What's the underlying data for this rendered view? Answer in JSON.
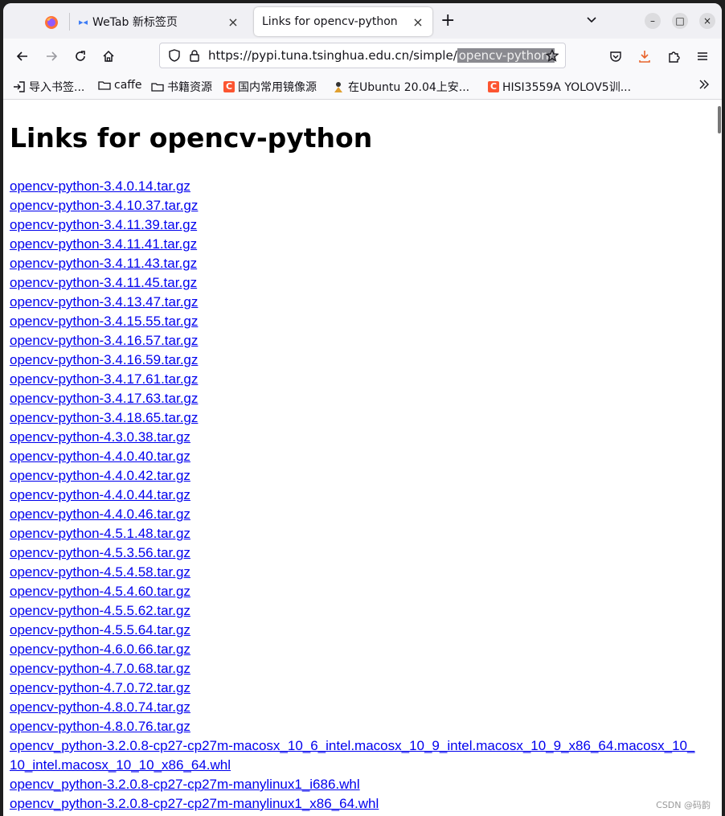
{
  "tabs": [
    {
      "title": "WeTab 新标签页",
      "close": "×"
    },
    {
      "title": "Links for opencv-python",
      "close": "×"
    }
  ],
  "window_controls": {
    "minimize": "–",
    "maximize": "□",
    "close": "×"
  },
  "url": {
    "base": "https://pypi.tuna.tsinghua.edu.cn/simple/",
    "selected": "opencv-python/"
  },
  "bookmarks": [
    {
      "label": "导入书签...",
      "icon": "import-icon"
    },
    {
      "label": "caffe",
      "icon": "folder-icon"
    },
    {
      "label": "书籍资源",
      "icon": "folder-icon"
    },
    {
      "label": "国内常用镜像源",
      "icon": "csdn-icon"
    },
    {
      "label": "在Ubuntu 20.04上安...",
      "icon": "ubuntu-icon"
    },
    {
      "label": "HISI3559A YOLOV5训...",
      "icon": "csdn-icon"
    }
  ],
  "page": {
    "title": "Links for opencv-python",
    "links": [
      "opencv-python-3.4.0.14.tar.gz",
      "opencv-python-3.4.10.37.tar.gz",
      "opencv-python-3.4.11.39.tar.gz",
      "opencv-python-3.4.11.41.tar.gz",
      "opencv-python-3.4.11.43.tar.gz",
      "opencv-python-3.4.11.45.tar.gz",
      "opencv-python-3.4.13.47.tar.gz",
      "opencv-python-3.4.15.55.tar.gz",
      "opencv-python-3.4.16.57.tar.gz",
      "opencv-python-3.4.16.59.tar.gz",
      "opencv-python-3.4.17.61.tar.gz",
      "opencv-python-3.4.17.63.tar.gz",
      "opencv-python-3.4.18.65.tar.gz",
      "opencv-python-4.3.0.38.tar.gz",
      "opencv-python-4.4.0.40.tar.gz",
      "opencv-python-4.4.0.42.tar.gz",
      "opencv-python-4.4.0.44.tar.gz",
      "opencv-python-4.4.0.46.tar.gz",
      "opencv-python-4.5.1.48.tar.gz",
      "opencv-python-4.5.3.56.tar.gz",
      "opencv-python-4.5.4.58.tar.gz",
      "opencv-python-4.5.4.60.tar.gz",
      "opencv-python-4.5.5.62.tar.gz",
      "opencv-python-4.5.5.64.tar.gz",
      "opencv-python-4.6.0.66.tar.gz",
      "opencv-python-4.7.0.68.tar.gz",
      "opencv-python-4.7.0.72.tar.gz",
      "opencv-python-4.8.0.74.tar.gz",
      "opencv-python-4.8.0.76.tar.gz",
      "opencv_python-3.2.0.8-cp27-cp27m-macosx_10_6_intel.macosx_10_9_intel.macosx_10_9_x86_64.macosx_10_10_intel.macosx_10_10_x86_64.whl",
      "opencv_python-3.2.0.8-cp27-cp27m-manylinux1_i686.whl",
      "opencv_python-3.2.0.8-cp27-cp27m-manylinux1_x86_64.whl"
    ]
  },
  "watermark": "CSDN @码韵"
}
